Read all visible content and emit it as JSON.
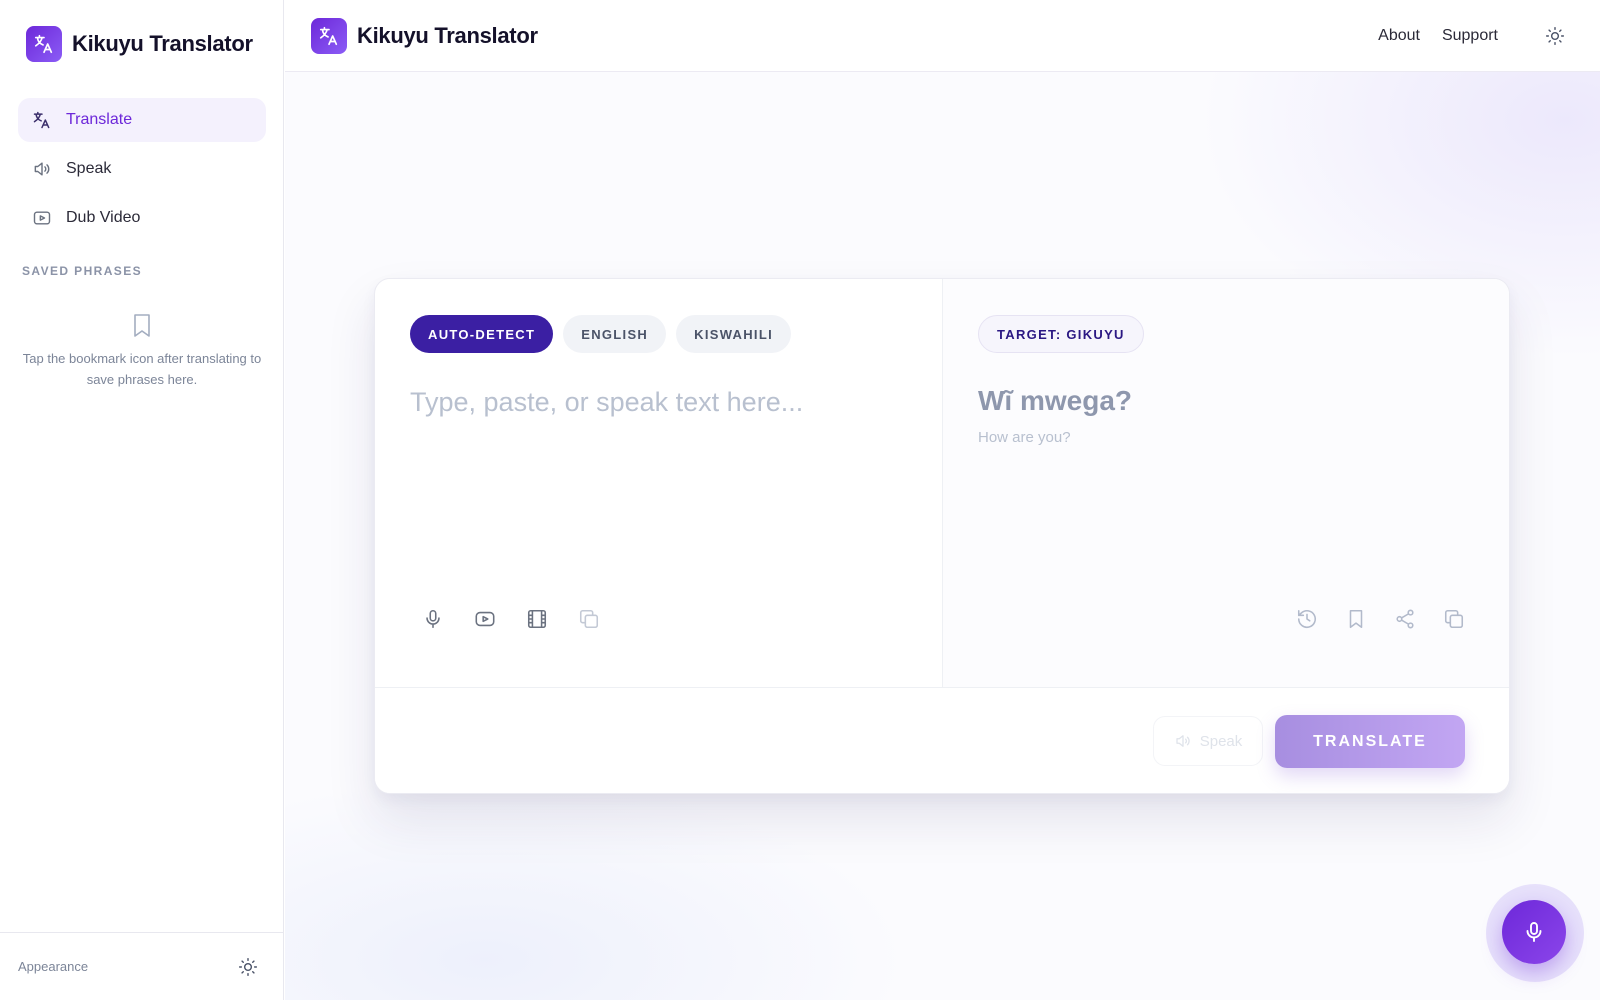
{
  "app": {
    "title": "Kikuyu Translator"
  },
  "sidebar": {
    "items": [
      {
        "label": "Translate",
        "icon": "translate-icon",
        "active": true
      },
      {
        "label": "Speak",
        "icon": "speaker-icon",
        "active": false
      },
      {
        "label": "Dub Video",
        "icon": "video-icon",
        "active": false
      }
    ],
    "saved_title": "SAVED PHRASES",
    "saved_empty": "Tap the bookmark icon after translating to save phrases here.",
    "appearance_label": "Appearance"
  },
  "header": {
    "links": [
      "About",
      "Support"
    ]
  },
  "translator": {
    "source_chips": [
      "AUTO-DETECT",
      "ENGLISH",
      "KISWAHILI"
    ],
    "active_chip": "AUTO-DETECT",
    "input_placeholder": "Type, paste, or speak text here...",
    "target_chip": "TARGET: GIKUYU",
    "output_text": "Wĩ mwega?",
    "output_sub": "How are you?",
    "speak_label": "Speak",
    "translate_label": "TRANSLATE"
  },
  "colors": {
    "accent": "#6d28d9",
    "accent_dark": "#3b1fa3",
    "translate_button": "#b39be9"
  }
}
